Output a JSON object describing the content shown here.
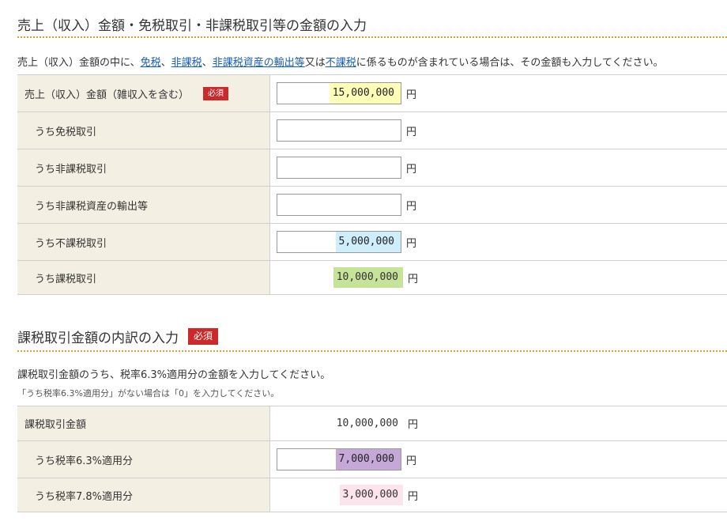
{
  "section1": {
    "title": "売上（収入）金額・免税取引・非課税取引等の金額の入力",
    "desc_pre": "売上（収入）金額の中に、",
    "link_menzei": "免税",
    "sep1": "、",
    "link_hikazei": "非課税",
    "sep2": "、",
    "link_export": "非課税資産の輸出等",
    "sep3": "又は",
    "link_fukazei": "不課税",
    "desc_post": "に係るものが含まれている場合は、その金額も入力してください。",
    "required_badge": "必須",
    "yen": "円",
    "rows": [
      {
        "label": "売上（収入）金額（雑収入を含む）",
        "value": "15,000,000",
        "highlight": "#ffffb8"
      },
      {
        "label": "うち免税取引",
        "value": ""
      },
      {
        "label": "うち非課税取引",
        "value": ""
      },
      {
        "label": "うち非課税資産の輸出等",
        "value": ""
      },
      {
        "label": "うち不課税取引",
        "value": "5,000,000",
        "highlight": "#cdeefa"
      },
      {
        "label": "うち課税取引",
        "value": "10,000,000",
        "highlight": "#c6e39a"
      }
    ]
  },
  "section2": {
    "title": "課税取引金額の内訳の入力",
    "required_badge": "必須",
    "desc": "課税取引金額のうち、税率6.3%適用分の金額を入力してください。",
    "note": "「うち税率6.3%適用分」がない場合は「0」を入力してください。",
    "yen": "円",
    "rows": [
      {
        "label": "課税取引金額",
        "value": "10,000,000"
      },
      {
        "label": "うち税率6.3%適用分",
        "value": "7,000,000",
        "highlight": "#c5a8d8"
      },
      {
        "label": "うち税率7.8%適用分",
        "value": "3,000,000",
        "highlight": "#fde3ec"
      }
    ]
  }
}
